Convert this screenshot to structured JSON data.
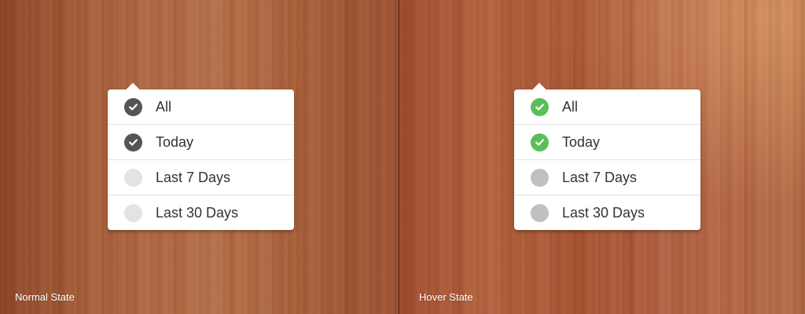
{
  "panels": {
    "normal": {
      "label": "Normal State",
      "items": [
        {
          "label": "All",
          "checked": true,
          "icon": "check-icon"
        },
        {
          "label": "Today",
          "checked": true,
          "icon": "check-icon"
        },
        {
          "label": "Last 7 Days",
          "checked": false,
          "icon": "empty-circle-icon"
        },
        {
          "label": "Last 30 Days",
          "checked": false,
          "icon": "empty-circle-icon"
        }
      ],
      "colors": {
        "checked": "#555555",
        "unchecked": "#e3e3e3"
      }
    },
    "hover": {
      "label": "Hover State",
      "items": [
        {
          "label": "All",
          "checked": true,
          "icon": "check-icon"
        },
        {
          "label": "Today",
          "checked": true,
          "icon": "check-icon"
        },
        {
          "label": "Last 7 Days",
          "checked": false,
          "icon": "empty-circle-icon"
        },
        {
          "label": "Last 30 Days",
          "checked": false,
          "icon": "empty-circle-icon"
        }
      ],
      "colors": {
        "checked": "#5cbe5a",
        "unchecked": "#c0c0c0"
      }
    }
  }
}
